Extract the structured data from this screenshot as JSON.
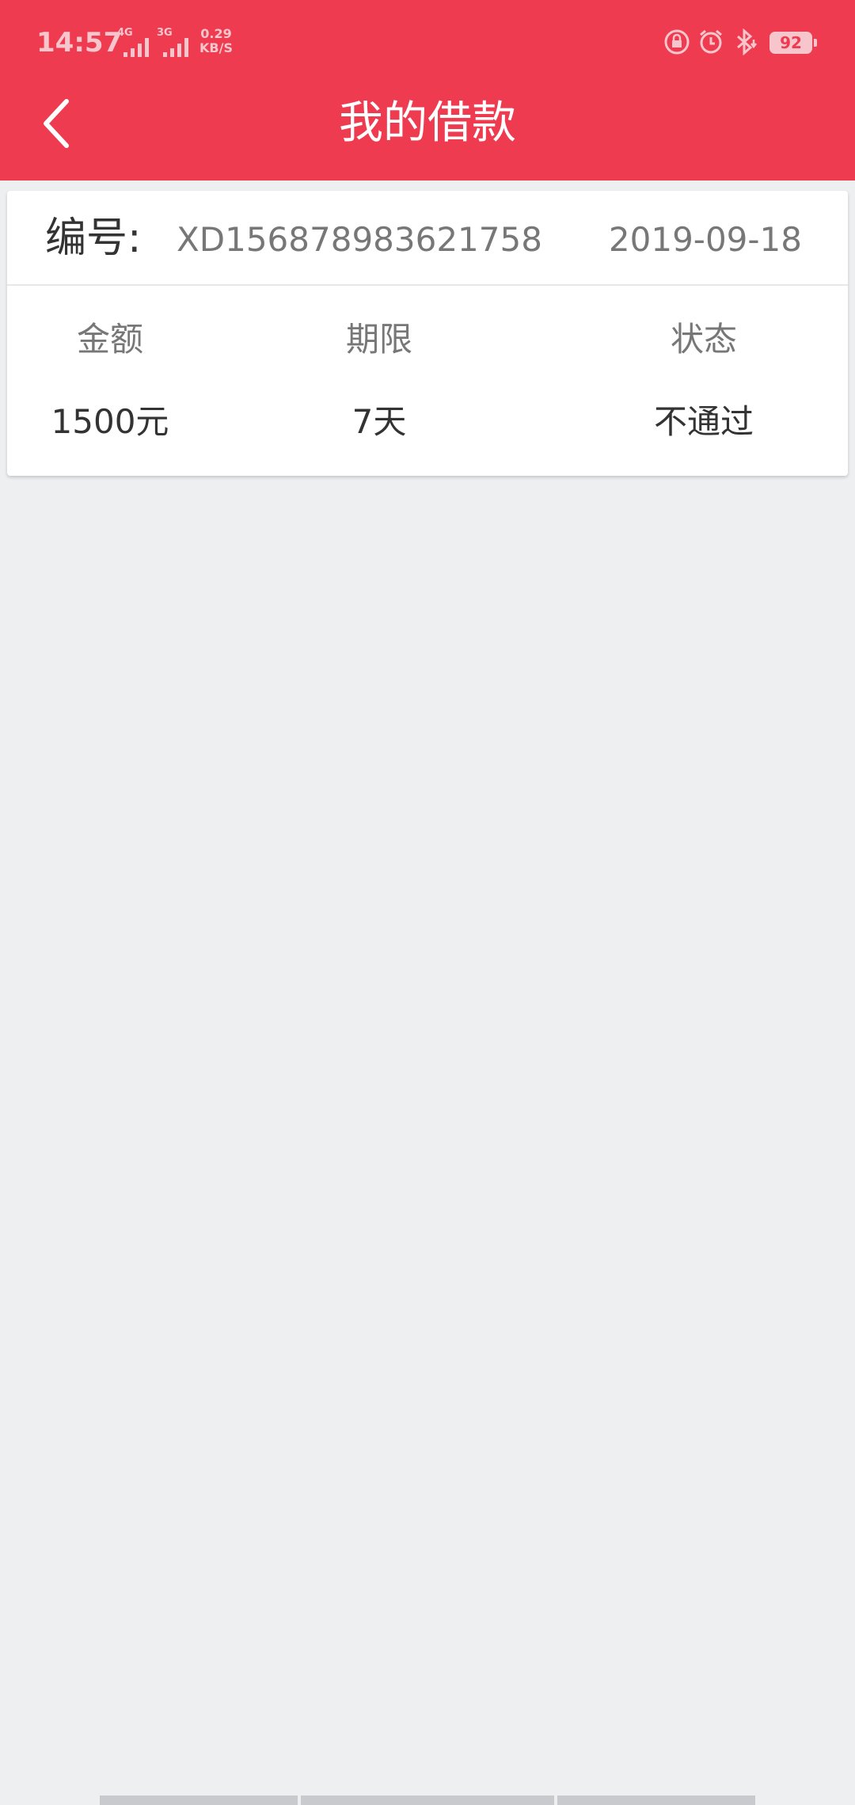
{
  "status_bar": {
    "time": "14:57",
    "sim1_type": "4G",
    "sim2_type": "3G",
    "net_speed": "0.29",
    "net_unit": "KB/S",
    "battery": "92",
    "icons": [
      "rotation-lock-icon",
      "alarm-icon",
      "bluetooth-icon",
      "battery-icon"
    ]
  },
  "header": {
    "title": "我的借款",
    "back_icon": "chevron-left-icon"
  },
  "loan": {
    "number_label": "编号:",
    "number": "XD156878983621758",
    "date": "2019-09-18",
    "columns": [
      {
        "label": "金额",
        "value": "1500元"
      },
      {
        "label": "期限",
        "value": "7天"
      },
      {
        "label": "状态",
        "value": "不通过"
      }
    ]
  },
  "colors": {
    "brand": "#ee3b50",
    "background": "#eeeff1",
    "card": "#ffffff"
  }
}
